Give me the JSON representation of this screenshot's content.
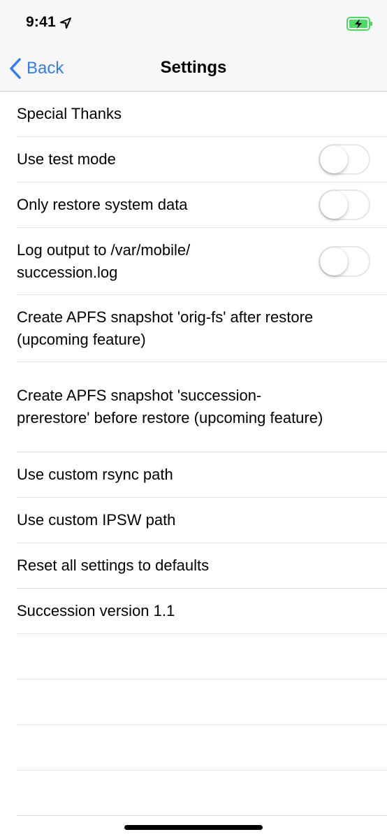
{
  "status_bar": {
    "time": "9:41",
    "location_icon": "location-arrow-icon",
    "battery_icon": "battery-charging-icon",
    "battery_color": "#4cd964"
  },
  "nav": {
    "back_label": "Back",
    "title": "Settings",
    "accent_color": "#2f7cf6"
  },
  "settings": {
    "items": [
      {
        "label": "Special Thanks",
        "toggle": false
      },
      {
        "label": "Use test mode",
        "toggle": true,
        "on": false
      },
      {
        "label": "Only restore system data",
        "toggle": true,
        "on": false
      },
      {
        "label": "Log output to /var/mobile/ succession.log",
        "toggle": true,
        "on": false
      },
      {
        "label": "Create APFS snapshot 'orig-fs' after restore (upcoming feature)",
        "toggle": false
      },
      {
        "label": "Create APFS snapshot 'succession-prerestore' before restore (upcoming feature)",
        "toggle": false
      },
      {
        "label": "Use custom rsync path",
        "toggle": false
      },
      {
        "label": "Use custom IPSW path",
        "toggle": false
      },
      {
        "label": "Reset all settings to defaults",
        "toggle": false
      },
      {
        "label": "Succession version 1.1",
        "toggle": false
      }
    ]
  }
}
